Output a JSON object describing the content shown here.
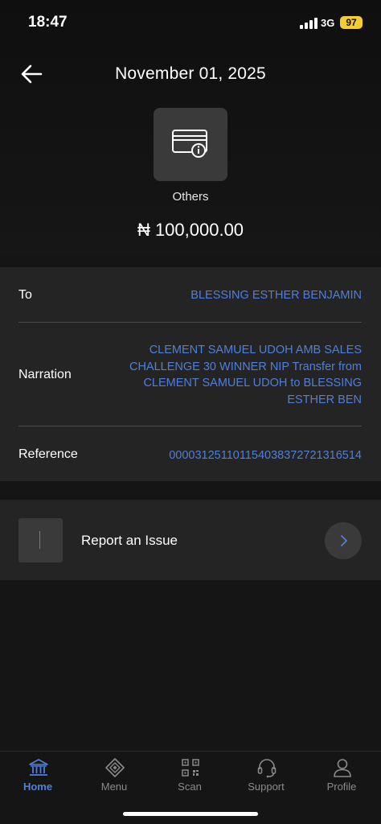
{
  "status_bar": {
    "time": "18:47",
    "network": "3G",
    "battery": "97"
  },
  "header": {
    "title": "November 01, 2025"
  },
  "transaction": {
    "category": "Others",
    "amount": "₦ 100,000.00"
  },
  "details": [
    {
      "label": "To",
      "value": "BLESSING ESTHER BENJAMIN"
    },
    {
      "label": "Narration",
      "lines": [
        "CLEMENT SAMUEL UDOH AMB SALES",
        "CHALLENGE 30 WINNER NIP Transfer from",
        "CLEMENT SAMUEL UDOH to BLESSING",
        "ESTHER BEN"
      ]
    },
    {
      "label": "Reference",
      "value": "000031251101154038372721316514"
    }
  ],
  "report": {
    "label": "Report an Issue"
  },
  "bottom_nav": [
    {
      "label": "Home",
      "icon": "bank-icon",
      "active": true
    },
    {
      "label": "Menu",
      "icon": "menu-diamond-icon"
    },
    {
      "label": "Scan",
      "icon": "qr-scan-icon"
    },
    {
      "label": "Support",
      "icon": "headset-icon"
    },
    {
      "label": "Profile",
      "icon": "profile-icon"
    }
  ],
  "colors": {
    "accent": "#4f7fdc",
    "background": "#151515",
    "card": "#242424",
    "battery": "#f5cd32"
  }
}
